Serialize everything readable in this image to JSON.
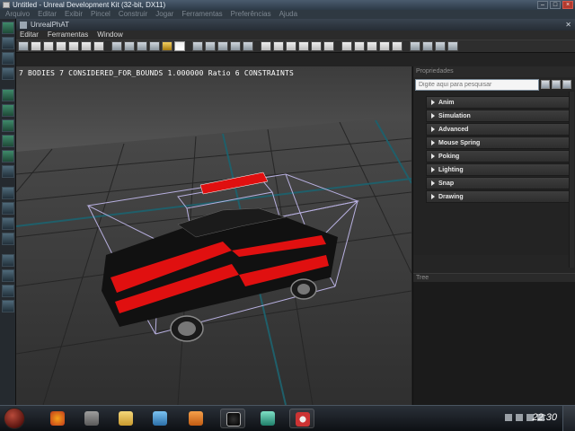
{
  "window": {
    "title": "Untitled - Unreal Development Kit (32-bit, DX11)",
    "menu": [
      "Arquivo",
      "Editar",
      "Exibir",
      "Pincel",
      "Construir",
      "Jogar",
      "Ferramentas",
      "Preferências",
      "Ajuda"
    ]
  },
  "editor": {
    "tab_title": "UnrealPhAT",
    "menu": [
      "Editar",
      "Ferramentas",
      "Window"
    ]
  },
  "viewport": {
    "stats": "7 BODIES  7 CONSIDERED_FOR_BOUNDS  1.000000 Ratio  6 CONSTRAINTS"
  },
  "properties": {
    "header": "Propriedades",
    "search_placeholder": "Digite aqui para pesquisar",
    "categories": [
      "Anim",
      "Simulation",
      "Advanced",
      "Mouse Spring",
      "Poking",
      "Lighting",
      "Snap",
      "Drawing"
    ]
  },
  "tree": {
    "header": "Tree"
  },
  "taskbar": {
    "clock": "22:30",
    "app_icons": [
      "firefox-icon",
      "folder-icon",
      "explorer-icon",
      "network-icon",
      "media-player-icon",
      "udk-icon",
      "gamemaker-icon",
      "chrome-icon"
    ]
  },
  "colors": {
    "car_body": "#111111",
    "car_stripe": "#e01010",
    "bounds_box": "#b8b0e0",
    "grid_major": "#1f5f6a"
  }
}
